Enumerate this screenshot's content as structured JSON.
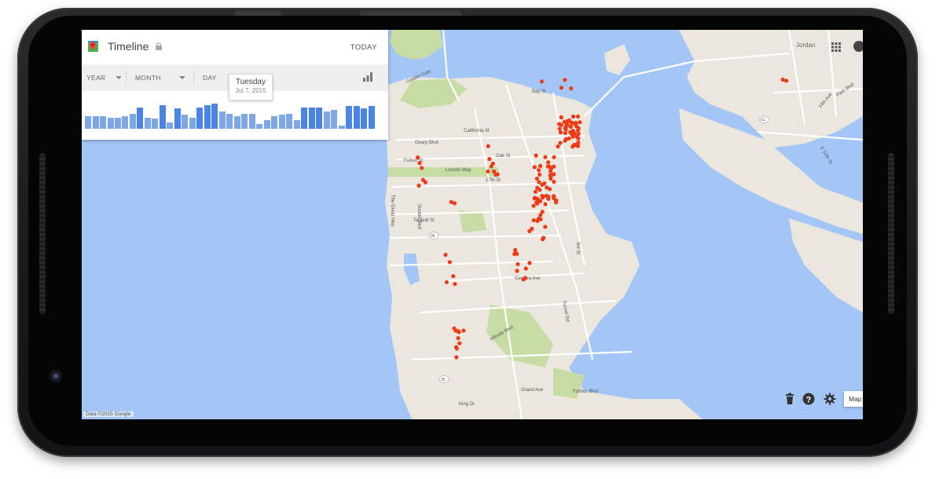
{
  "app": {
    "title": "Timeline",
    "today_label": "TODAY",
    "brand_colors": {
      "panel": "#ffffff",
      "bar": "#7ea7e8",
      "bar_active": "#4a85e6",
      "point": "#ee3a16",
      "water": "#a3c6f7",
      "land": "#ebe7df",
      "park": "#c7dca4"
    }
  },
  "selectors": {
    "year": "YEAR",
    "month": "MONTH",
    "day": "DAY"
  },
  "tooltip": {
    "weekday": "Tuesday",
    "date": "Jul 7, 2015"
  },
  "histogram": {
    "values": [
      0.5,
      0.5,
      0.5,
      0.45,
      0.45,
      0.5,
      0.6,
      0.85,
      0.45,
      0.4,
      0.95,
      0.25,
      0.8,
      0.55,
      0.45,
      0.85,
      0.95,
      1.0,
      0.7,
      0.6,
      0.5,
      0.6,
      0.6,
      0.2,
      0.35,
      0.5,
      0.55,
      0.6,
      0.35,
      0.85,
      0.85,
      0.85,
      0.7,
      0.75,
      0.12,
      0.9,
      0.9,
      0.8,
      0.9
    ]
  },
  "map": {
    "labels": {
      "golden_gate": "Golden Gate",
      "jordan": "Jordan",
      "bay_st": "Bay St",
      "california_st": "California St",
      "geary_blvd": "Geary Blvd",
      "fulton_st": "Fulton St",
      "oak_st": "Oak St",
      "lincoln_way": "Lincoln Way",
      "17th_st": "17th St",
      "sunset_blvd": "Sunset Blvd",
      "taraval_st": "Taraval St",
      "great_hwy": "The Great Hwy",
      "geneva_ave": "Geneva Ave",
      "hillside_blvd": "Hillside Blvd",
      "grand_ave": "Grand Ave",
      "king_dr": "King Dr",
      "forbes_blvd": "Forbes Blvd",
      "3rd_st": "3rd St",
      "tunnel_rd": "Tunnel Rd",
      "park_blvd": "Park Blvd",
      "14th_ave": "14th Ave",
      "e_12th_st": "E 12th St",
      "hwy_35": "35",
      "hwy_61": "61"
    },
    "credit": "Data ©2015 Google"
  },
  "controls": {
    "map_type": "Map"
  }
}
